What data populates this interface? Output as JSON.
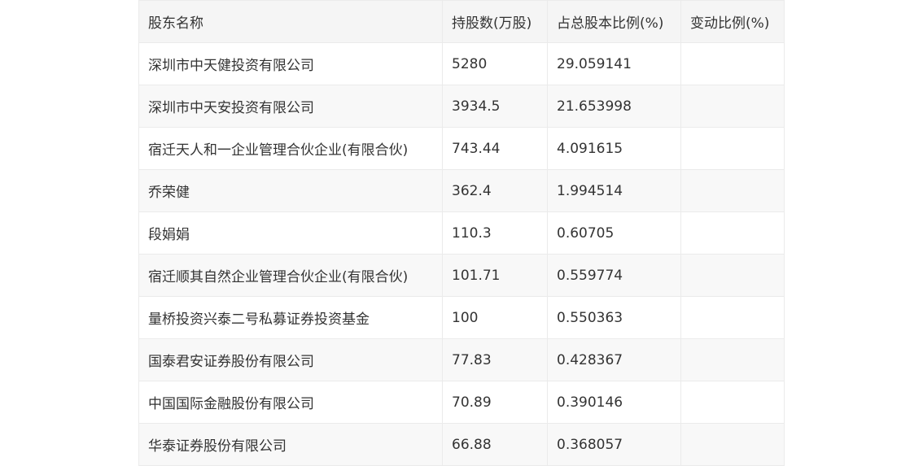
{
  "table": {
    "headers": [
      "股东名称",
      "持股数(万股)",
      "占总股本比例(%)",
      "变动比例(%)"
    ],
    "rows": [
      [
        "深圳市中天健投资有限公司",
        "5280",
        "29.059141",
        ""
      ],
      [
        "深圳市中天安投资有限公司",
        "3934.5",
        "21.653998",
        ""
      ],
      [
        "宿迁天人和一企业管理合伙企业(有限合伙)",
        "743.44",
        "4.091615",
        ""
      ],
      [
        "乔荣健",
        "362.4",
        "1.994514",
        ""
      ],
      [
        "段娟娟",
        "110.3",
        "0.60705",
        ""
      ],
      [
        "宿迁顺其自然企业管理合伙企业(有限合伙)",
        "101.71",
        "0.559774",
        ""
      ],
      [
        "量桥投资兴泰二号私募证券投资基金",
        "100",
        "0.550363",
        ""
      ],
      [
        "国泰君安证券股份有限公司",
        "77.83",
        "0.428367",
        ""
      ],
      [
        "中国国际金融股份有限公司",
        "70.89",
        "0.390146",
        ""
      ],
      [
        "华泰证券股份有限公司",
        "66.88",
        "0.368057",
        ""
      ]
    ]
  }
}
